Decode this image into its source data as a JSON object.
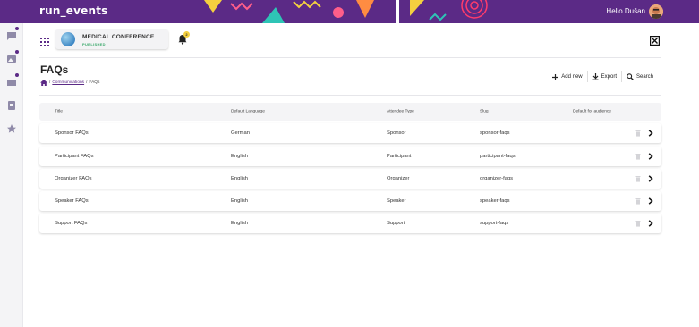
{
  "topbar": {
    "logo": "run_events",
    "greeting": "Hello Dušan",
    "brand_color": "#5b2a86"
  },
  "rail": {
    "items": [
      {
        "icon": "chat-icon",
        "has_dot": true
      },
      {
        "icon": "image-icon",
        "has_dot": true
      },
      {
        "icon": "folder-icon",
        "has_dot": true
      },
      {
        "icon": "document-icon",
        "has_dot": false
      },
      {
        "icon": "star-icon",
        "has_dot": false
      }
    ]
  },
  "event": {
    "name": "MEDICAL CONFERENCE",
    "status": "PUBLISHED",
    "notifications": "2"
  },
  "page": {
    "title": "FAQs",
    "breadcrumb": {
      "separator": "/",
      "link": "Communications",
      "current": "FAQs"
    }
  },
  "actions": {
    "add_new": "Add new",
    "export": "Export",
    "search": "Search"
  },
  "table": {
    "columns": [
      "Title",
      "Default Language",
      "Attendee Type",
      "Slug",
      "Default for audience"
    ],
    "rows": [
      {
        "title": "Sponsor FAQs",
        "language": "German",
        "attendee_type": "Sponsor",
        "slug": "sponsor-faqs"
      },
      {
        "title": "Participant FAQs",
        "language": "English",
        "attendee_type": "Participant",
        "slug": "participant-faqs"
      },
      {
        "title": "Organizer FAQs",
        "language": "English",
        "attendee_type": "Organizer",
        "slug": "organizer-faqs"
      },
      {
        "title": "Speaker FAQs",
        "language": "English",
        "attendee_type": "Speaker",
        "slug": "speaker-faqs"
      },
      {
        "title": "Support FAQs",
        "language": "English",
        "attendee_type": "Support",
        "slug": "support-faqs"
      }
    ]
  }
}
